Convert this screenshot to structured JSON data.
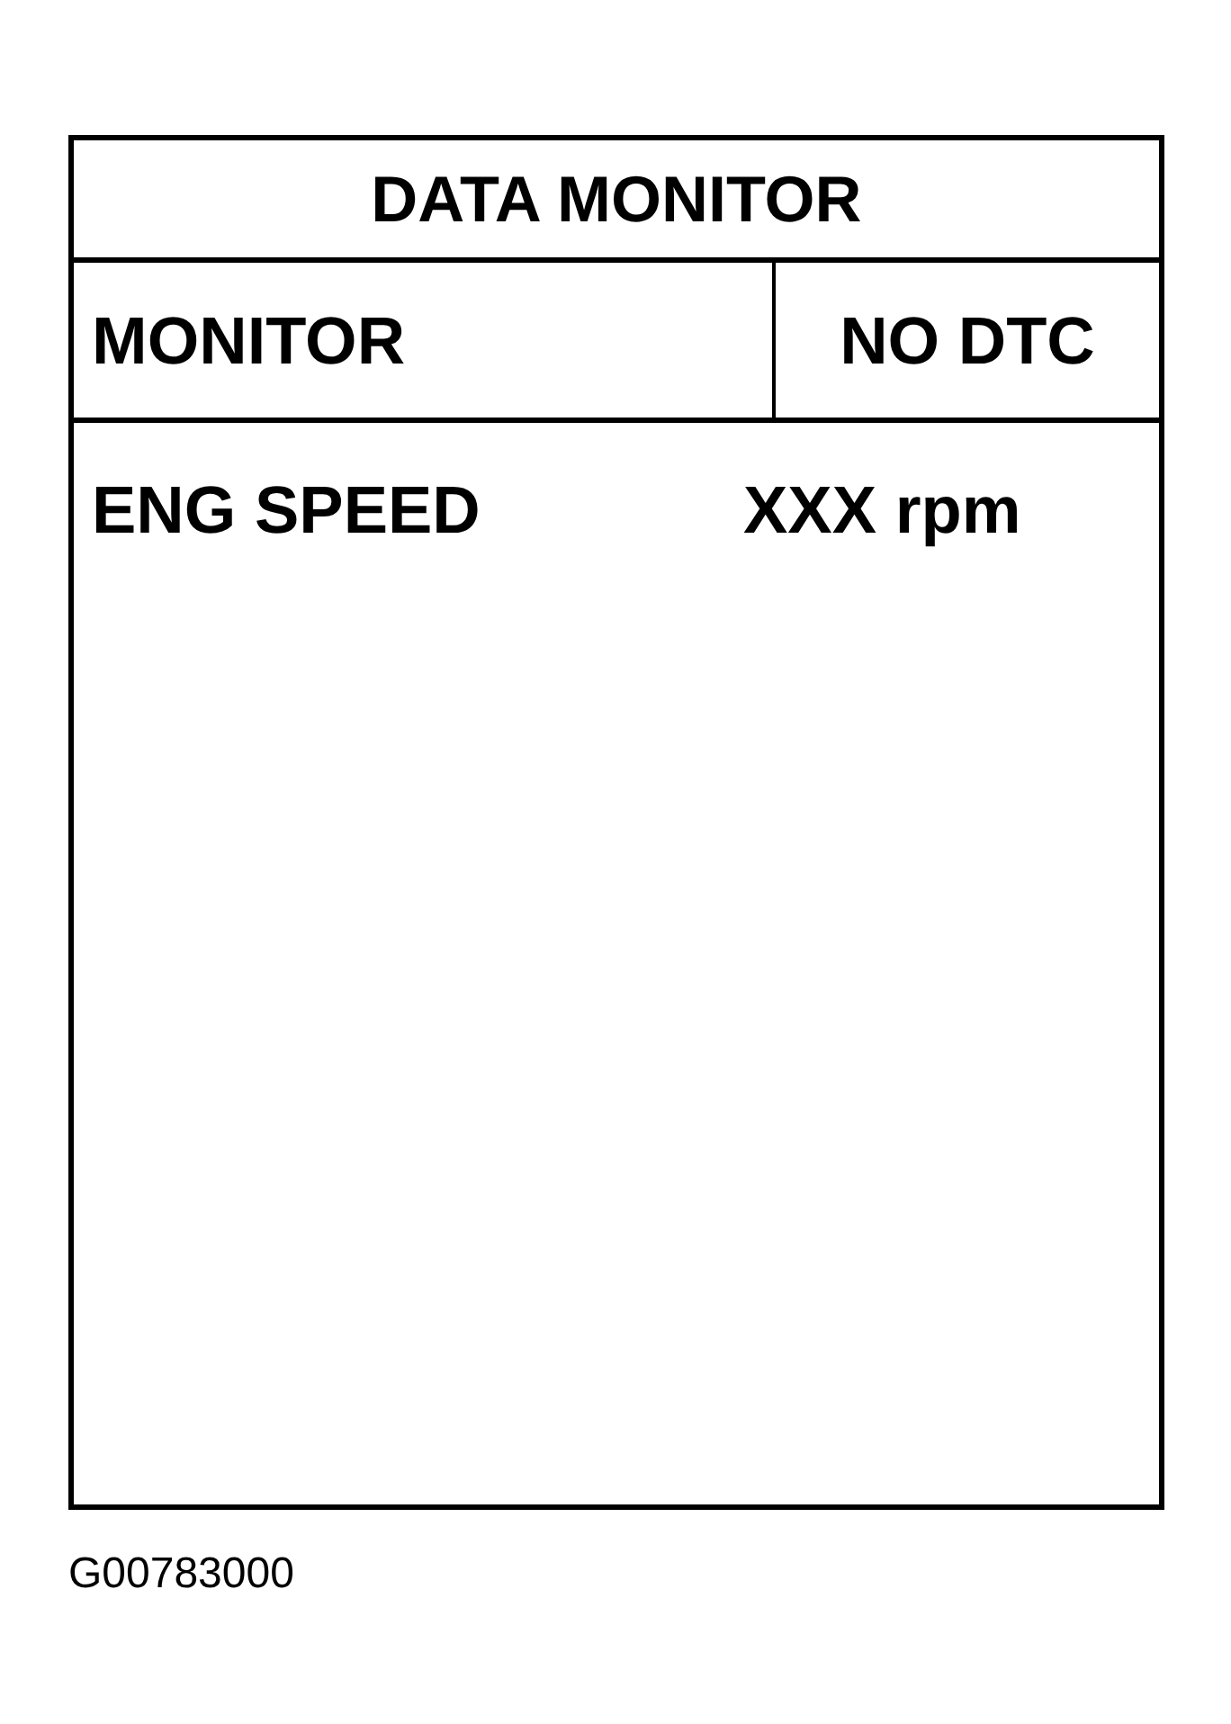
{
  "title": "DATA MONITOR",
  "header": {
    "mode": "MONITOR",
    "status": "NO DTC"
  },
  "rows": [
    {
      "label": "ENG SPEED",
      "value": "XXX rpm"
    }
  ],
  "figure_id": "G00783000"
}
